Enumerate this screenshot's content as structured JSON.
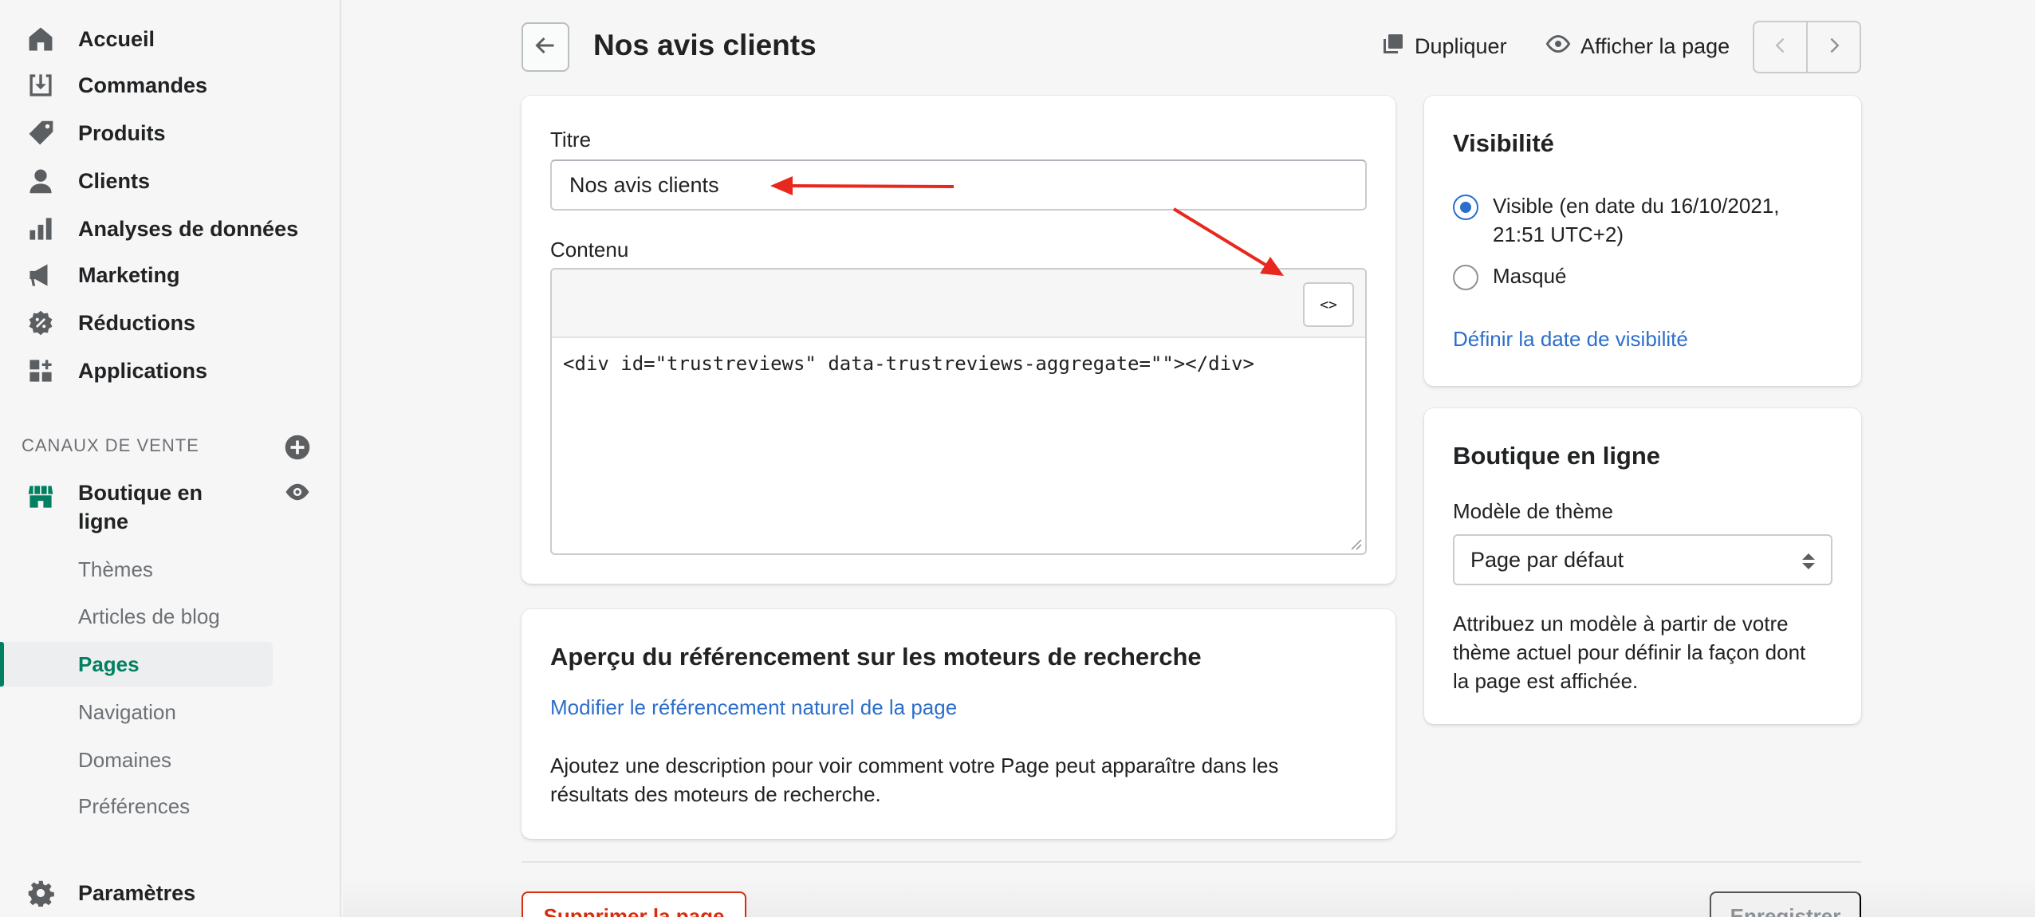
{
  "sidebar": {
    "items": [
      {
        "label": "Accueil",
        "icon": "home-icon"
      },
      {
        "label": "Commandes",
        "icon": "orders-icon"
      },
      {
        "label": "Produits",
        "icon": "tag-icon"
      },
      {
        "label": "Clients",
        "icon": "person-icon"
      },
      {
        "label": "Analyses de données",
        "icon": "bar-chart-icon"
      },
      {
        "label": "Marketing",
        "icon": "megaphone-icon"
      },
      {
        "label": "Réductions",
        "icon": "discount-icon"
      },
      {
        "label": "Applications",
        "icon": "apps-icon"
      }
    ],
    "sales_channels_title": "CANAUX DE VENTE",
    "store": {
      "label": "Boutique en\nligne",
      "icon": "store-icon"
    },
    "sub_items": [
      "Thèmes",
      "Articles de blog",
      "Pages",
      "Navigation",
      "Domaines",
      "Préférences"
    ],
    "active_sub_item": "Pages",
    "settings_label": "Paramètres"
  },
  "header": {
    "title": "Nos avis clients",
    "duplicate_label": "Dupliquer",
    "view_page_label": "Afficher la page"
  },
  "main_card": {
    "title_label": "Titre",
    "title_value": "Nos avis clients",
    "content_label": "Contenu",
    "code_button_label": "<>",
    "content_code": "<div id=\"trustreviews\" data-trustreviews-aggregate=\"\"></div>"
  },
  "seo_card": {
    "heading": "Aperçu du référencement sur les moteurs de recherche",
    "edit_link": "Modifier le référencement naturel de la page",
    "description_line1": "Ajoutez une description pour voir comment votre Page peut apparaître dans les",
    "description_line2": "résultats des moteurs de recherche."
  },
  "visibility_card": {
    "heading": "Visibilité",
    "visible_label_line1": "Visible (en date du 16/10/2021,",
    "visible_label_line2": "21:51 UTC+2)",
    "hidden_label": "Masqué",
    "selected": "visible",
    "set_date_link": "Définir la date de visibilité"
  },
  "store_card": {
    "heading": "Boutique en ligne",
    "template_label": "Modèle de thème",
    "template_value": "Page par défaut",
    "help_line1": "Attribuez un modèle à partir de votre",
    "help_line2": "thème actuel pour définir la façon dont",
    "help_line3": "la page est affichée."
  },
  "footer": {
    "delete_label": "Supprimer la page",
    "save_label": "Enregistrer"
  },
  "colors": {
    "accent_green": "#008060",
    "link_blue": "#2c6ecb",
    "danger_red": "#d72c0d",
    "annotation_red": "#e8281e"
  }
}
